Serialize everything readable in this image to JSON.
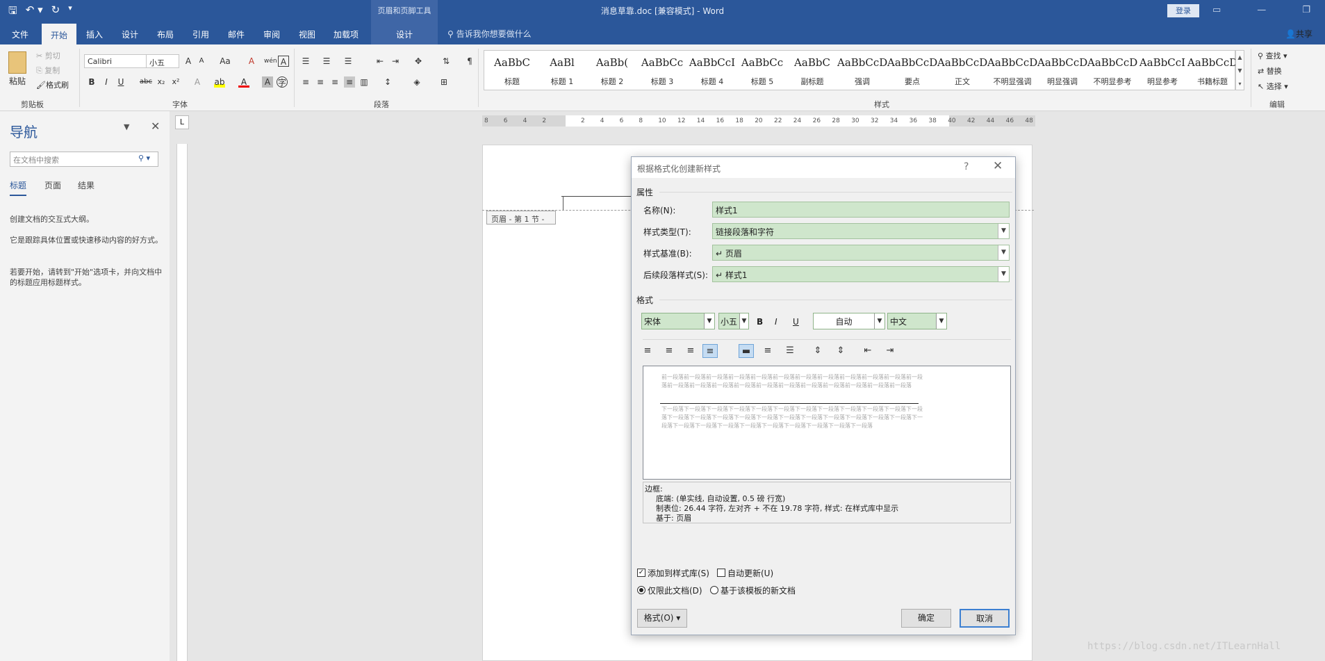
{
  "titlebar": {
    "document_title": "消息草靠.doc [兼容模式]  -  Word",
    "context_tools": "页眉和页脚工具",
    "login": "登录"
  },
  "tabs": {
    "file": "文件",
    "home": "开始",
    "insert": "插入",
    "design": "设计",
    "layout": "布局",
    "references": "引用",
    "mailings": "邮件",
    "review": "审阅",
    "view": "视图",
    "addins": "加载项",
    "hf_design": "设计",
    "tellme": "告诉我你想要做什么",
    "share": "共享"
  },
  "ribbon": {
    "clipboard": {
      "paste": "粘贴",
      "cut": "剪切",
      "copy": "复制",
      "format_painter": "格式刷",
      "label": "剪贴板"
    },
    "font": {
      "name": "Calibri",
      "size": "小五",
      "label": "字体"
    },
    "paragraph": {
      "label": "段落"
    },
    "styles": {
      "label": "样式",
      "items": [
        {
          "sample": "AaBbC",
          "name": "标题"
        },
        {
          "sample": "AaBl",
          "name": "标题 1"
        },
        {
          "sample": "AaBb(",
          "name": "标题 2"
        },
        {
          "sample": "AaBbCc",
          "name": "标题 3"
        },
        {
          "sample": "AaBbCcI",
          "name": "标题 4"
        },
        {
          "sample": "AaBbCc",
          "name": "标题 5"
        },
        {
          "sample": "AaBbC",
          "name": "副标题"
        },
        {
          "sample": "AaBbCcD",
          "name": "强调"
        },
        {
          "sample": "AaBbCcD",
          "name": "要点"
        },
        {
          "sample": "AaBbCcDd",
          "name": "正文"
        },
        {
          "sample": "AaBbCcD",
          "name": "不明显强调"
        },
        {
          "sample": "AaBbCcD",
          "name": "明显强调"
        },
        {
          "sample": "AaBbCcD",
          "name": "不明显参考"
        },
        {
          "sample": "AaBbCcI",
          "name": "明显参考"
        },
        {
          "sample": "AaBbCcD",
          "name": "书籍标题"
        }
      ]
    },
    "editing": {
      "find": "查找",
      "replace": "替换",
      "select": "选择",
      "label": "编辑"
    }
  },
  "nav": {
    "title": "导航",
    "search_placeholder": "在文档中搜索",
    "tab_headings": "标题",
    "tab_pages": "页面",
    "tab_results": "结果",
    "p1": "创建文档的交互式大纲。",
    "p2": "它是跟踪具体位置或快速移动内容的好方式。",
    "p3": "若要开始，请转到\"开始\"选项卡，并向文档中的标题应用标题样式。"
  },
  "ruler": {
    "corner": "L",
    "numbers": [
      "8",
      "6",
      "4",
      "2",
      "",
      "2",
      "4",
      "6",
      "8",
      "10",
      "12",
      "14",
      "16",
      "18",
      "20",
      "22",
      "24",
      "26",
      "28",
      "30",
      "32",
      "34",
      "36",
      "38",
      "40",
      "42",
      "44",
      "46",
      "48"
    ]
  },
  "document": {
    "header_tab": "页眉 - 第 1 节 -"
  },
  "dialog": {
    "title": "根据格式化创建新样式",
    "help": "?",
    "close": "✕",
    "props_label": "属性",
    "name_label": "名称(N):",
    "name_value": "样式1",
    "type_label": "样式类型(T):",
    "type_value": "链接段落和字符",
    "based_label": "样式基准(B):",
    "based_value": "↵ 页眉",
    "next_label": "后续段落样式(S):",
    "next_value": "↵ 样式1",
    "format_label": "格式",
    "font": "宋体",
    "size": "小五",
    "color": "自动",
    "script": "中文",
    "preview_prev": "前一段落前一段落前一段落前一段落前一段落前一段落前一段落前一段落前一段落前一段落前一段落前一段落前一段落前一段落前一段落前一段落前一段落前一段落前一段落前一段落前一段落前一段落前一段落",
    "preview_next": "下一段落下一段落下一段落下一段落下一段落下一段落下一段落下一段落下一段落下一段落下一段落下一段落下一段落下一段落下一段落下一段落下一段落下一段落下一段落下一段落下一段落下一段落下一段落下一段落下一段落下一段落下一段落下一段落下一段落下一段落下一段落下一段落下一段落",
    "desc_title": "边框:",
    "desc_line1": "底端: (单实线, 自动设置, 0.5 磅 行宽)",
    "desc_line2": "制表位: 26.44 字符, 左对齐 + 不在  19.78 字符, 样式: 在样式库中显示",
    "desc_line3": "基于: 页眉",
    "add_gallery": "添加到样式库(S)",
    "auto_update": "自动更新(U)",
    "only_doc": "仅限此文档(D)",
    "new_docs": "基于该模板的新文档",
    "format_btn": "格式(O) ▾",
    "ok": "确定",
    "cancel": "取消"
  },
  "watermark": "https://blog.csdn.net/ITLearnHall"
}
